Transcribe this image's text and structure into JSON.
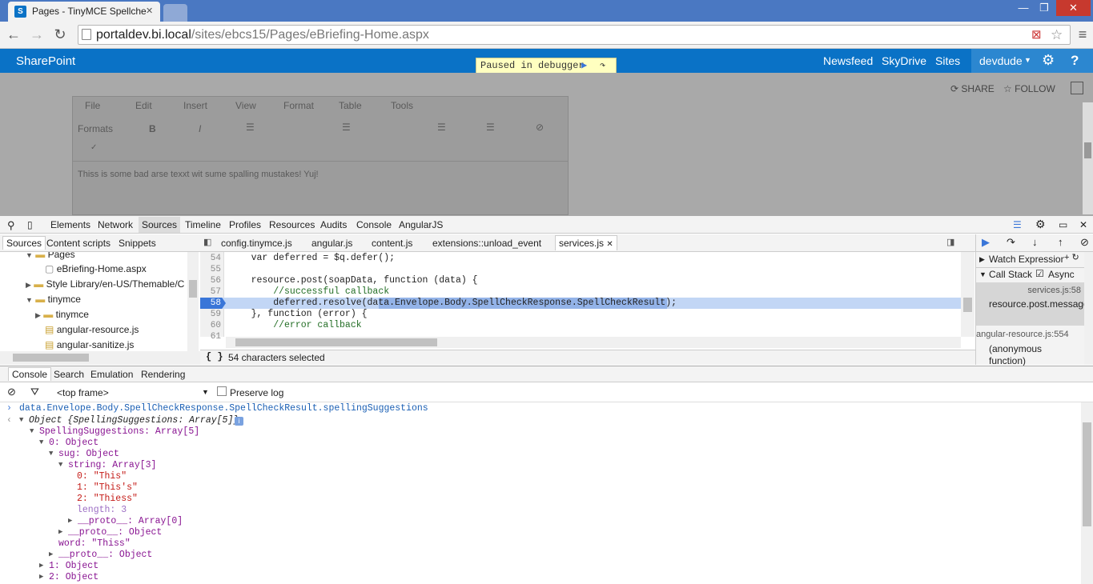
{
  "browser": {
    "tab_title": "Pages - TinyMCE Spellche",
    "url_host": "portaldev.bi.local",
    "url_path": "/sites/ebcs15/Pages/eBriefing-Home.aspx",
    "win_min": "—",
    "win_max": "❐",
    "win_close": "✕"
  },
  "sharepoint": {
    "brand": "SharePoint",
    "links": [
      "Newsfeed",
      "SkyDrive",
      "Sites"
    ],
    "user": "devdude",
    "share": "SHARE",
    "follow": "FOLLOW",
    "paused": "Paused in debugger"
  },
  "editor": {
    "menus": [
      "File",
      "Edit",
      "Insert",
      "View",
      "Format",
      "Table",
      "Tools"
    ],
    "formats": "Formats",
    "bold": "B",
    "italic": "I",
    "text": "Thiss is some bad arse texxt wit sume spalling mustakes! Yuj!"
  },
  "devtools": {
    "panels": [
      "Elements",
      "Network",
      "Sources",
      "Timeline",
      "Profiles",
      "Resources",
      "Audits",
      "Console",
      "AngularJS"
    ],
    "nav_tabs": [
      "Sources",
      "Content scripts",
      "Snippets"
    ],
    "file_tabs": [
      "config.tinymce.js",
      "angular.js",
      "content.js",
      "extensions::unload_event",
      "services.js"
    ],
    "tree": [
      "Pages",
      "eBriefing-Home.aspx",
      "Style Library/en-US/Themable/C",
      "tinymce",
      "tinymce",
      "angular-resource.js",
      "angular-sanitize.js"
    ],
    "line_numbers": [
      "54",
      "55",
      "56",
      "57",
      "58",
      "59",
      "60",
      "61"
    ],
    "code_lines": [
      "    var deferred = $q.defer();",
      "",
      "    resource.post(soapData, function (data) {",
      "        //successful callback",
      "        deferred.resolve(data.Envelope.Body.SpellCheckResponse.SpellCheckResult);",
      "    }, function (error) {",
      "        //error callback",
      ""
    ],
    "status": "54 characters selected",
    "watch": "Watch Expressions",
    "call_stack": "Call Stack",
    "async": "Async",
    "stack_file1": "services.js:58",
    "stack_fn1": "resource.post.message",
    "stack_file2": "angular-resource.js:554",
    "stack_fn2": "(anonymous function)"
  },
  "console": {
    "tabs": [
      "Console",
      "Search",
      "Emulation",
      "Rendering"
    ],
    "frame": "<top frame>",
    "preserve": "Preserve log",
    "command": "data.Envelope.Body.SpellCheckResponse.SpellCheckResult.spellingSuggestions",
    "lines": [
      "Object {SpellingSuggestions: Array[5]}",
      "SpellingSuggestions: Array[5]",
      "0: Object",
      "sug: Object",
      "string: Array[3]",
      "0: \"This\"",
      "1: \"This's\"",
      "2: \"Thiess\"",
      "length: 3",
      "__proto__: Array[0]",
      "__proto__: Object",
      "word: \"Thiss\"",
      "__proto__: Object",
      "1: Object",
      "2: Object"
    ]
  }
}
